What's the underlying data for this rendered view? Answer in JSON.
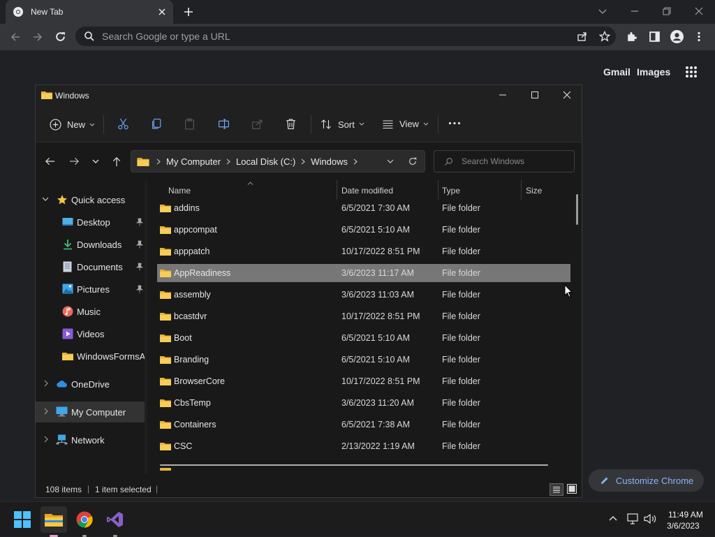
{
  "chrome": {
    "tab_title": "New Tab",
    "omnibox_placeholder": "Search Google or type a URL",
    "ntp_links": [
      "Gmail",
      "Images"
    ],
    "customize_label": "Customize Chrome"
  },
  "explorer": {
    "window_title": "Windows",
    "toolbar": {
      "new_label": "New",
      "sort_label": "Sort",
      "view_label": "View"
    },
    "breadcrumb": [
      "My Computer",
      "Local Disk (C:)",
      "Windows"
    ],
    "search_placeholder": "Search Windows",
    "nav": [
      {
        "label": "Quick access",
        "icon": "star-icon"
      },
      {
        "label": "Desktop",
        "icon": "desktop-icon",
        "pinned": true
      },
      {
        "label": "Downloads",
        "icon": "download-icon",
        "pinned": true
      },
      {
        "label": "Documents",
        "icon": "document-icon",
        "pinned": true
      },
      {
        "label": "Pictures",
        "icon": "pictures-icon",
        "pinned": true
      },
      {
        "label": "Music",
        "icon": "music-icon"
      },
      {
        "label": "Videos",
        "icon": "videos-icon"
      },
      {
        "label": "WindowsFormsAp",
        "icon": "folder-icon"
      },
      {
        "label": "OneDrive",
        "icon": "cloud-icon"
      },
      {
        "label": "My Computer",
        "icon": "computer-icon"
      },
      {
        "label": "Network",
        "icon": "network-icon"
      }
    ],
    "columns": [
      "Name",
      "Date modified",
      "Type",
      "Size"
    ],
    "files": [
      {
        "name": "addins",
        "date": "6/5/2021 7:30 AM",
        "type": "File folder"
      },
      {
        "name": "appcompat",
        "date": "6/5/2021 5:10 AM",
        "type": "File folder"
      },
      {
        "name": "apppatch",
        "date": "10/17/2022 8:51 PM",
        "type": "File folder"
      },
      {
        "name": "AppReadiness",
        "date": "3/6/2023 11:17 AM",
        "type": "File folder"
      },
      {
        "name": "assembly",
        "date": "3/6/2023 11:03 AM",
        "type": "File folder"
      },
      {
        "name": "bcastdvr",
        "date": "10/17/2022 8:51 PM",
        "type": "File folder"
      },
      {
        "name": "Boot",
        "date": "6/5/2021 5:10 AM",
        "type": "File folder"
      },
      {
        "name": "Branding",
        "date": "6/5/2021 5:10 AM",
        "type": "File folder"
      },
      {
        "name": "BrowserCore",
        "date": "10/17/2022 8:51 PM",
        "type": "File folder"
      },
      {
        "name": "CbsTemp",
        "date": "3/6/2023 11:20 AM",
        "type": "File folder"
      },
      {
        "name": "Containers",
        "date": "6/5/2021 7:38 AM",
        "type": "File folder"
      },
      {
        "name": "CSC",
        "date": "2/13/2022 1:19 AM",
        "type": "File folder"
      }
    ],
    "status": {
      "item_count": "108 items",
      "selected": "1 item selected"
    }
  },
  "taskbar": {
    "time": "11:49 AM",
    "date": "3/6/2023"
  }
}
